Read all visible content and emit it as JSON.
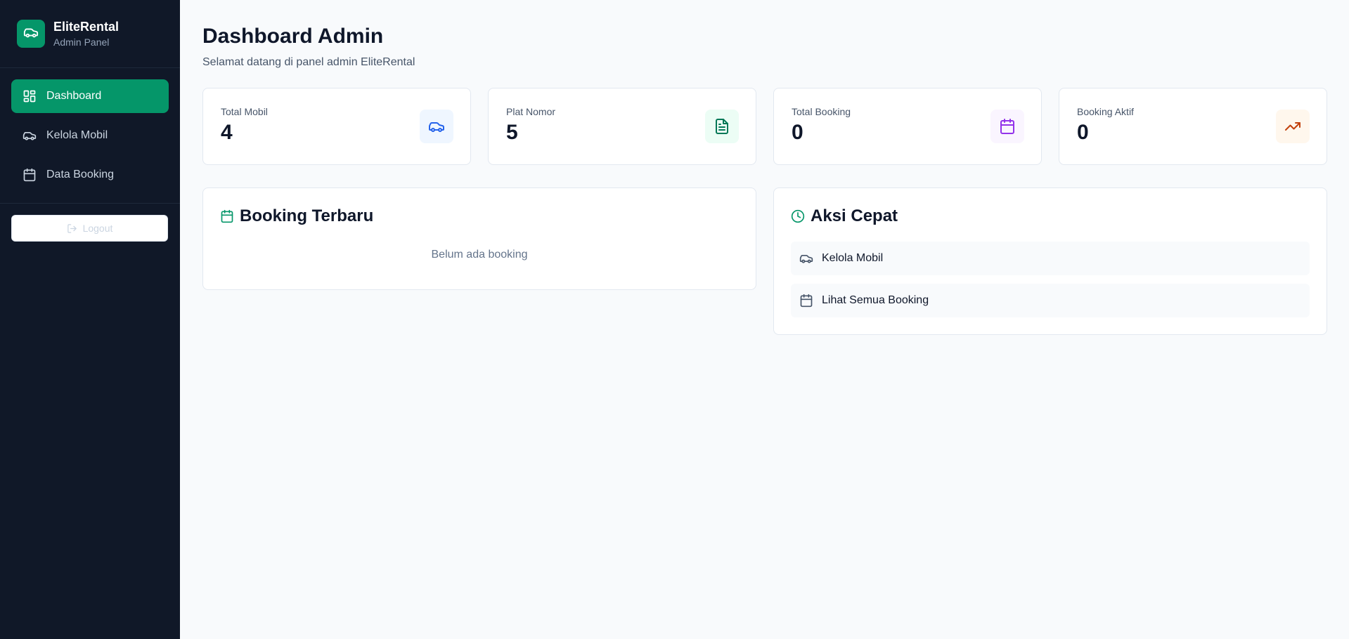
{
  "brand": {
    "name": "EliteRental",
    "subtitle": "Admin Panel",
    "icon": "car-icon"
  },
  "sidebar": {
    "items": [
      {
        "label": "Dashboard",
        "icon": "layout-grid-icon",
        "active": true
      },
      {
        "label": "Kelola Mobil",
        "icon": "car-icon",
        "active": false
      },
      {
        "label": "Data Booking",
        "icon": "calendar-icon",
        "active": false
      }
    ],
    "logout_label": "Logout"
  },
  "header": {
    "title": "Dashboard Admin",
    "subtitle": "Selamat datang di panel admin EliteRental"
  },
  "stats": [
    {
      "label": "Total Mobil",
      "value": "4",
      "icon": "car-icon",
      "color": "#2563eb",
      "bg": "#eff6ff"
    },
    {
      "label": "Plat Nomor",
      "value": "5",
      "icon": "file-text-icon",
      "color": "#047857",
      "bg": "#ecfdf5"
    },
    {
      "label": "Total Booking",
      "value": "0",
      "icon": "calendar-icon",
      "color": "#9333ea",
      "bg": "#faf5ff"
    },
    {
      "label": "Booking Aktif",
      "value": "0",
      "icon": "trending-up-icon",
      "color": "#c2410c",
      "bg": "#fff7ed"
    }
  ],
  "recent_bookings": {
    "title": "Booking Terbaru",
    "empty_text": "Belum ada booking"
  },
  "quick_actions": {
    "title": "Aksi Cepat",
    "items": [
      {
        "label": "Kelola Mobil",
        "icon": "car-icon"
      },
      {
        "label": "Lihat Semua Booking",
        "icon": "calendar-icon"
      }
    ]
  },
  "colors": {
    "accent": "#059669",
    "sidebar_bg": "#101828",
    "page_bg": "#f8fafc"
  }
}
